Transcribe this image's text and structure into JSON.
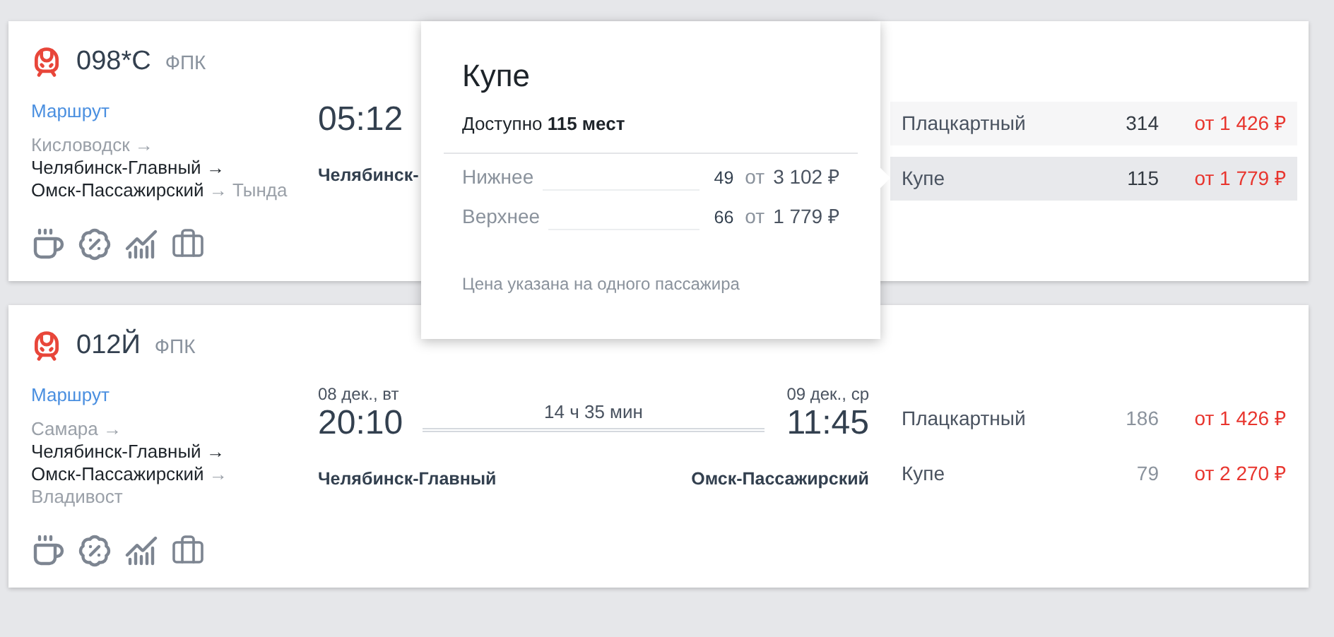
{
  "trains": [
    {
      "number": "098*С",
      "carrier": "ФПК",
      "active": true,
      "route_link": "Маршрут",
      "route": [
        {
          "text": "Кисловодск",
          "muted": true
        },
        {
          "text": "→",
          "muted": true
        },
        {
          "text": "Челябинск-Главный",
          "muted": false
        },
        {
          "text": "→",
          "muted": false
        },
        {
          "text": "Омск-Пассажирский",
          "muted": false
        },
        {
          "text": "→",
          "muted": true
        },
        {
          "text": "Тында",
          "muted": true
        }
      ],
      "departure": {
        "time": "05:12",
        "station": "Челябинск-"
      },
      "seats": [
        {
          "class": "Плацкартный",
          "count": "314",
          "price": "от 1 426 ₽",
          "selected": false
        },
        {
          "class": "Купе",
          "count": "115",
          "price": "от 1 779 ₽",
          "selected": true
        }
      ]
    },
    {
      "number": "012Й",
      "carrier": "ФПК",
      "active": false,
      "route_link": "Маршрут",
      "route": [
        {
          "text": "Самара",
          "muted": true
        },
        {
          "text": "→",
          "muted": true
        },
        {
          "text": "Челябинск-Главный",
          "muted": false
        },
        {
          "text": "→",
          "muted": false
        },
        {
          "text": "Омск-Пассажирский",
          "muted": false
        },
        {
          "text": "→",
          "muted": true
        },
        {
          "text": "Владивост",
          "muted": true
        }
      ],
      "departure": {
        "date": "08 дек., вт",
        "time": "20:10",
        "station": "Челябинск-Главный"
      },
      "duration": "14 ч 35 мин",
      "arrival": {
        "date": "09 дек., ср",
        "time": "11:45",
        "station": "Омск-Пассажирский"
      },
      "seats": [
        {
          "class": "Плацкартный",
          "count": "186",
          "price": "от 1 426 ₽",
          "selected": false
        },
        {
          "class": "Купе",
          "count": "79",
          "price": "от 2 270 ₽",
          "selected": false
        }
      ]
    }
  ],
  "popup": {
    "title": "Купе",
    "availability": "Доступно **115 мест**",
    "berths": [
      {
        "name": "Нижнее",
        "count": "49",
        "from": "от",
        "price": "3 102 ₽"
      },
      {
        "name": "Верхнее",
        "count": "66",
        "from": "от",
        "price": "1 779 ₽"
      }
    ],
    "note": "Цена указана на одного пассажира"
  }
}
